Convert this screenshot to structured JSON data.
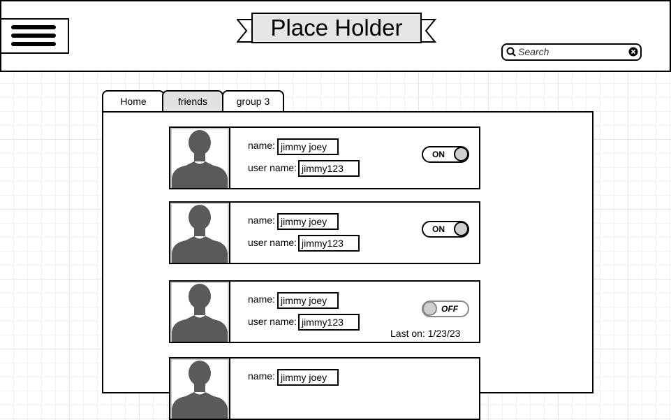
{
  "header": {
    "title": "Place Holder",
    "menu_icon": "hamburger-menu-icon",
    "search": {
      "placeholder": "Search",
      "value": "",
      "icon": "search-icon",
      "clear_icon": "clear-icon"
    }
  },
  "tabs": [
    {
      "label": "Home",
      "active": false
    },
    {
      "label": "friends",
      "active": true
    },
    {
      "label": "group 3",
      "active": false
    }
  ],
  "friends": [
    {
      "name_label": "name:",
      "name": "jimmy joey",
      "username_label": "user name:",
      "username": "jimmy123",
      "status": "ON"
    },
    {
      "name_label": "name:",
      "name": "jimmy joey",
      "username_label": "user name:",
      "username": "jimmy123",
      "status": "ON"
    },
    {
      "name_label": "name:",
      "name": "jimmy joey",
      "username_label": "user name:",
      "username": "jimmy123",
      "status": "OFF",
      "last_on": "Last on: 1/23/23"
    },
    {
      "name_label": "name:",
      "name": "jimmy joey"
    }
  ]
}
